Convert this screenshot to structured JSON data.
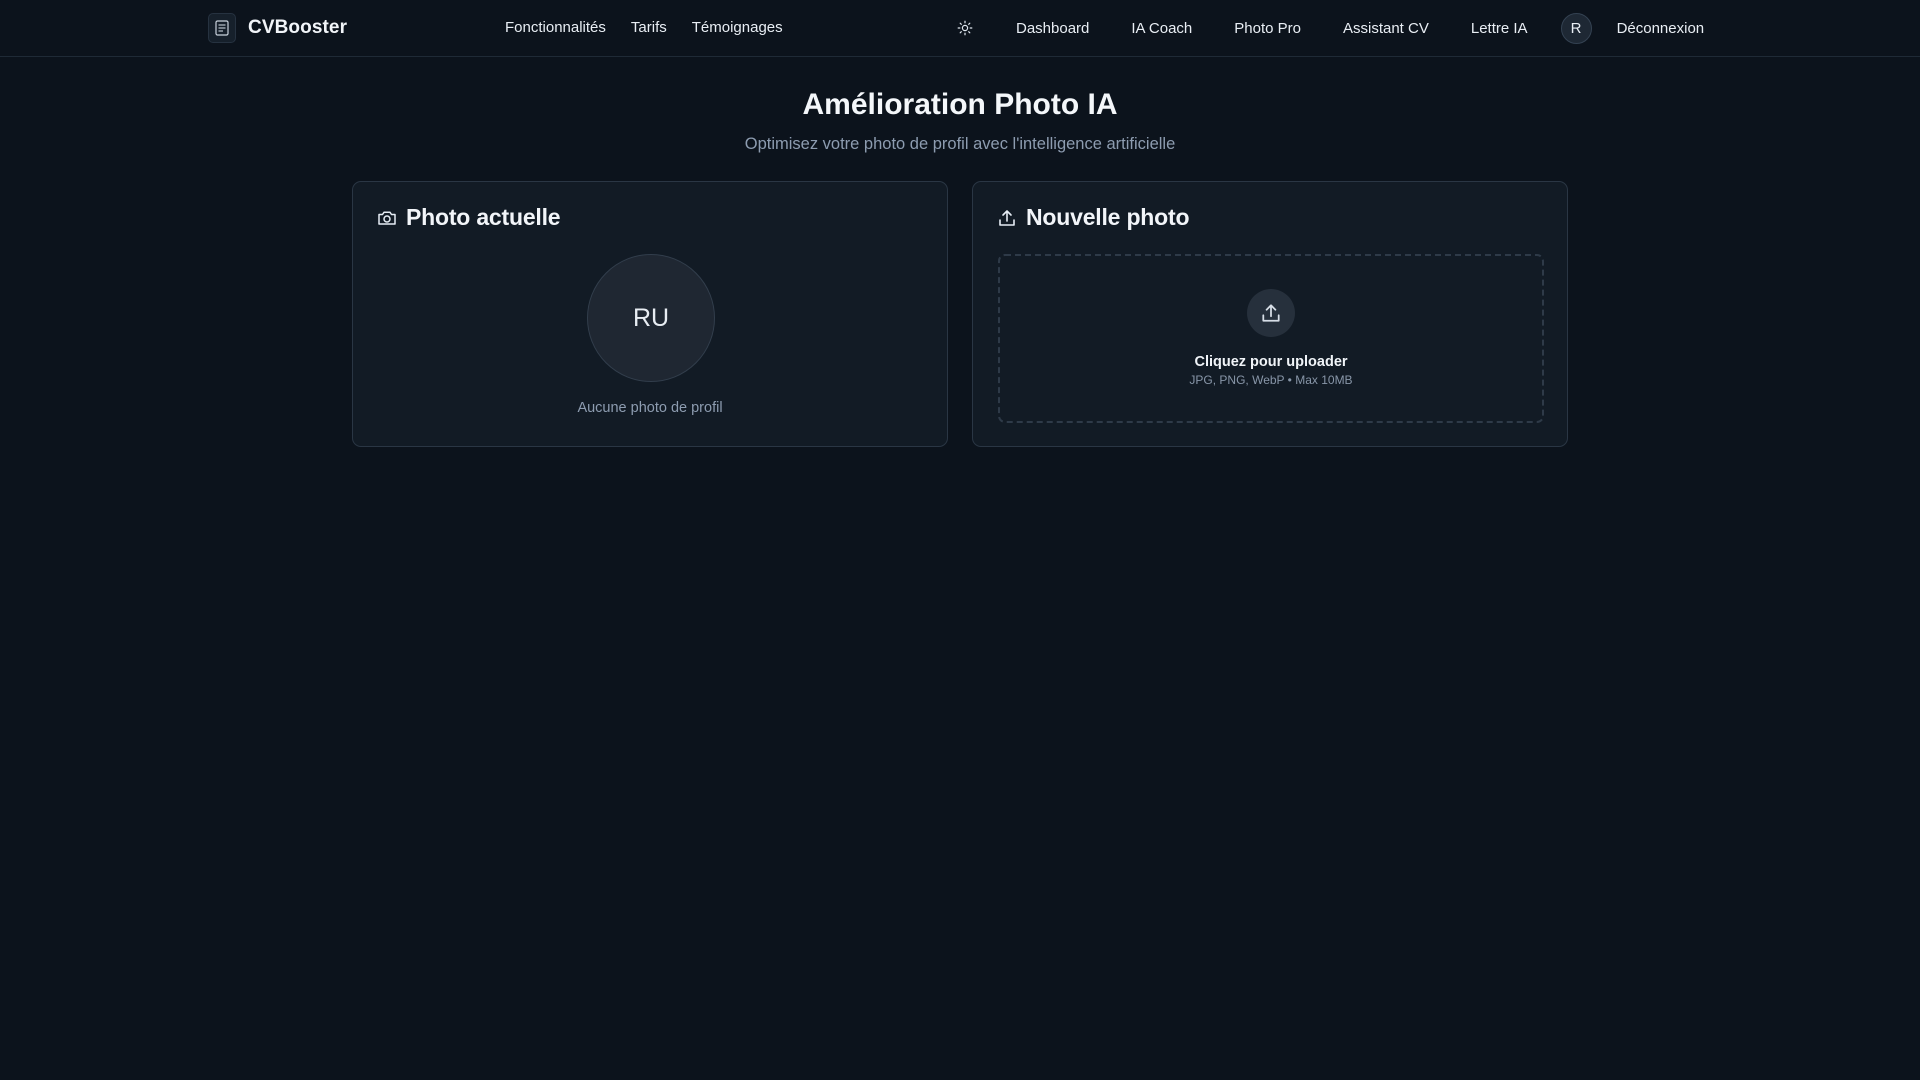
{
  "header": {
    "brand": "CVBooster",
    "nav_left": [
      "Fonctionnalités",
      "Tarifs",
      "Témoignages"
    ],
    "nav_right": [
      "Dashboard",
      "IA Coach",
      "Photo Pro",
      "Assistant CV",
      "Lettre IA"
    ],
    "user_initial": "R",
    "logout": "Déconnexion",
    "icons": {
      "logo": "document-icon",
      "theme": "sun-icon"
    }
  },
  "page": {
    "title": "Amélioration Photo IA",
    "subtitle": "Optimisez votre photo de profil avec l'intelligence artificielle"
  },
  "current_photo": {
    "title": "Photo actuelle",
    "icon": "camera-icon",
    "initials": "RU",
    "empty_text": "Aucune photo de profil"
  },
  "new_photo": {
    "title": "Nouvelle photo",
    "icon": "upload-icon",
    "cta": "Cliquez pour uploader",
    "hint": "JPG, PNG, WebP • Max 10MB"
  },
  "colors": {
    "background": "#0c131c",
    "card": "#121b25",
    "border": "#2a3644",
    "muted_text": "#8d9cb0"
  }
}
